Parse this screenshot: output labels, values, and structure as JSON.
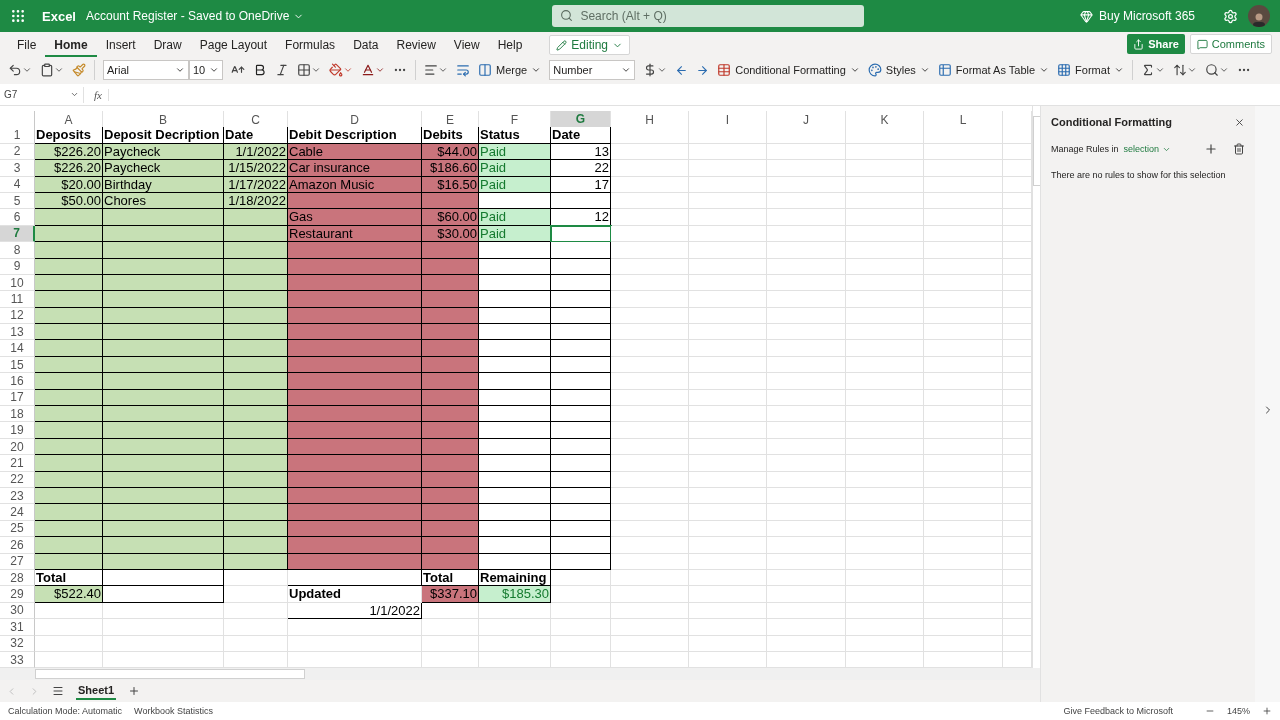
{
  "app": {
    "name": "Excel",
    "document": "Account Register - Saved to OneDrive"
  },
  "search": {
    "placeholder": "Search (Alt + Q)"
  },
  "account": {
    "buy": "Buy Microsoft 365"
  },
  "menu_tabs": [
    {
      "label": "File",
      "selected": false
    },
    {
      "label": "Home",
      "selected": true
    },
    {
      "label": "Insert",
      "selected": false
    },
    {
      "label": "Draw",
      "selected": false
    },
    {
      "label": "Page Layout",
      "selected": false
    },
    {
      "label": "Formulas",
      "selected": false
    },
    {
      "label": "Data",
      "selected": false
    },
    {
      "label": "Review",
      "selected": false
    },
    {
      "label": "View",
      "selected": false
    },
    {
      "label": "Help",
      "selected": false
    }
  ],
  "mode": "Editing",
  "share": "Share",
  "comments": "Comments",
  "toolbar": {
    "font": "Arial",
    "size": "10",
    "merge": "Merge",
    "number_format": "Number",
    "conditional_formatting": "Conditional Formatting",
    "styles": "Styles",
    "format_as_table": "Format As Table",
    "format": "Format"
  },
  "formula_bar": {
    "name_box": "G7",
    "fx": "fx"
  },
  "columns": [
    {
      "label": "A",
      "selected": false
    },
    {
      "label": "B",
      "selected": false
    },
    {
      "label": "C",
      "selected": false
    },
    {
      "label": "D",
      "selected": false
    },
    {
      "label": "E",
      "selected": false
    },
    {
      "label": "F",
      "selected": false
    },
    {
      "label": "G",
      "selected": true
    },
    {
      "label": "H",
      "selected": false
    },
    {
      "label": "I",
      "selected": false
    },
    {
      "label": "J",
      "selected": false
    },
    {
      "label": "K",
      "selected": false
    },
    {
      "label": "L",
      "selected": false
    }
  ],
  "rows": [
    {
      "number": "1",
      "selected": false,
      "cells": [
        {
          "text": "Deposits",
          "kind": "boxed",
          "bold": true
        },
        {
          "text": "Deposit Decription",
          "kind": "boxed",
          "bold": true
        },
        {
          "text": "Date",
          "kind": "boxed",
          "bold": true
        },
        {
          "text": "Debit Description",
          "kind": "boxed",
          "bold": true
        },
        {
          "text": "Debits",
          "kind": "boxed",
          "bold": true
        },
        {
          "text": "Status",
          "kind": "boxed",
          "bold": true
        },
        {
          "text": "Date",
          "kind": "boxed",
          "bold": true
        }
      ]
    },
    {
      "number": "2",
      "selected": false,
      "cells": [
        {
          "text": "$226.20",
          "kind": "deposit",
          "right_aligned": true
        },
        {
          "text": "Paycheck",
          "kind": "deposit"
        },
        {
          "text": "1/1/2022",
          "kind": "deposit",
          "right_aligned": true
        },
        {
          "text": "Cable",
          "kind": "debit"
        },
        {
          "text": "$44.00",
          "kind": "debit",
          "right_aligned": true
        },
        {
          "text": "Paid",
          "kind": "paid"
        },
        {
          "text": "13",
          "kind": "boxed",
          "right_aligned": true
        }
      ]
    },
    {
      "number": "3",
      "selected": false,
      "cells": [
        {
          "text": "$226.20",
          "kind": "deposit",
          "right_aligned": true
        },
        {
          "text": "Paycheck",
          "kind": "deposit"
        },
        {
          "text": "1/15/2022",
          "kind": "deposit",
          "right_aligned": true
        },
        {
          "text": "Car insurance",
          "kind": "debit"
        },
        {
          "text": "$186.60",
          "kind": "debit",
          "right_aligned": true
        },
        {
          "text": "Paid",
          "kind": "paid"
        },
        {
          "text": "22",
          "kind": "boxed",
          "right_aligned": true
        }
      ]
    },
    {
      "number": "4",
      "selected": false,
      "cells": [
        {
          "text": "$20.00",
          "kind": "deposit",
          "right_aligned": true
        },
        {
          "text": "Birthday",
          "kind": "deposit"
        },
        {
          "text": "1/17/2022",
          "kind": "deposit",
          "right_aligned": true
        },
        {
          "text": "Amazon Music",
          "kind": "debit"
        },
        {
          "text": "$16.50",
          "kind": "debit",
          "right_aligned": true
        },
        {
          "text": "Paid",
          "kind": "paid"
        },
        {
          "text": "17",
          "kind": "boxed",
          "right_aligned": true
        }
      ]
    },
    {
      "number": "5",
      "selected": false,
      "cells": [
        {
          "text": "$50.00",
          "kind": "deposit",
          "right_aligned": true
        },
        {
          "text": "Chores",
          "kind": "deposit"
        },
        {
          "text": "1/18/2022",
          "kind": "deposit",
          "right_aligned": true
        },
        {
          "kind": "debit"
        },
        {
          "kind": "debit"
        },
        {
          "kind": "boxed"
        },
        {
          "kind": "boxed"
        }
      ]
    },
    {
      "number": "6",
      "selected": false,
      "cells": [
        {
          "kind": "deposit"
        },
        {
          "kind": "deposit"
        },
        {
          "kind": "deposit"
        },
        {
          "text": "Gas",
          "kind": "debit"
        },
        {
          "text": "$60.00",
          "kind": "debit",
          "right_aligned": true
        },
        {
          "text": "Paid",
          "kind": "paid"
        },
        {
          "text": "12",
          "kind": "boxed",
          "right_aligned": true
        }
      ]
    },
    {
      "number": "7",
      "selected": true,
      "cells": [
        {
          "kind": "deposit"
        },
        {
          "kind": "deposit"
        },
        {
          "kind": "deposit"
        },
        {
          "text": "Restaurant",
          "kind": "debit"
        },
        {
          "text": "$30.00",
          "kind": "debit",
          "right_aligned": true
        },
        {
          "text": "Paid",
          "kind": "paid"
        },
        {
          "kind": "boxed"
        }
      ]
    },
    {
      "number": "8",
      "selected": false,
      "cells": [
        {
          "kind": "deposit"
        },
        {
          "kind": "deposit"
        },
        {
          "kind": "deposit"
        },
        {
          "kind": "debit"
        },
        {
          "kind": "debit"
        },
        {
          "kind": "boxed"
        },
        {
          "kind": "boxed"
        }
      ]
    },
    {
      "number": "9",
      "selected": false,
      "cells": [
        {
          "kind": "deposit"
        },
        {
          "kind": "deposit"
        },
        {
          "kind": "deposit"
        },
        {
          "kind": "debit"
        },
        {
          "kind": "debit"
        },
        {
          "kind": "boxed"
        },
        {
          "kind": "boxed"
        }
      ]
    },
    {
      "number": "10",
      "selected": false,
      "cells": [
        {
          "kind": "deposit"
        },
        {
          "kind": "deposit"
        },
        {
          "kind": "deposit"
        },
        {
          "kind": "debit"
        },
        {
          "kind": "debit"
        },
        {
          "kind": "boxed"
        },
        {
          "kind": "boxed"
        }
      ]
    },
    {
      "number": "11",
      "selected": false,
      "cells": [
        {
          "kind": "deposit"
        },
        {
          "kind": "deposit"
        },
        {
          "kind": "deposit"
        },
        {
          "kind": "debit"
        },
        {
          "kind": "debit"
        },
        {
          "kind": "boxed"
        },
        {
          "kind": "boxed"
        }
      ]
    },
    {
      "number": "12",
      "selected": false,
      "cells": [
        {
          "kind": "deposit"
        },
        {
          "kind": "deposit"
        },
        {
          "kind": "deposit"
        },
        {
          "kind": "debit"
        },
        {
          "kind": "debit"
        },
        {
          "kind": "boxed"
        },
        {
          "kind": "boxed"
        }
      ]
    },
    {
      "number": "13",
      "selected": false,
      "cells": [
        {
          "kind": "deposit"
        },
        {
          "kind": "deposit"
        },
        {
          "kind": "deposit"
        },
        {
          "kind": "debit"
        },
        {
          "kind": "debit"
        },
        {
          "kind": "boxed"
        },
        {
          "kind": "boxed"
        }
      ]
    },
    {
      "number": "14",
      "selected": false,
      "cells": [
        {
          "kind": "deposit"
        },
        {
          "kind": "deposit"
        },
        {
          "kind": "deposit"
        },
        {
          "kind": "debit"
        },
        {
          "kind": "debit"
        },
        {
          "kind": "boxed"
        },
        {
          "kind": "boxed"
        }
      ]
    },
    {
      "number": "15",
      "selected": false,
      "cells": [
        {
          "kind": "deposit"
        },
        {
          "kind": "deposit"
        },
        {
          "kind": "deposit"
        },
        {
          "kind": "debit"
        },
        {
          "kind": "debit"
        },
        {
          "kind": "boxed"
        },
        {
          "kind": "boxed"
        }
      ]
    },
    {
      "number": "16",
      "selected": false,
      "cells": [
        {
          "kind": "deposit"
        },
        {
          "kind": "deposit"
        },
        {
          "kind": "deposit"
        },
        {
          "kind": "debit"
        },
        {
          "kind": "debit"
        },
        {
          "kind": "boxed"
        },
        {
          "kind": "boxed"
        }
      ]
    },
    {
      "number": "17",
      "selected": false,
      "cells": [
        {
          "kind": "deposit"
        },
        {
          "kind": "deposit"
        },
        {
          "kind": "deposit"
        },
        {
          "kind": "debit"
        },
        {
          "kind": "debit"
        },
        {
          "kind": "boxed"
        },
        {
          "kind": "boxed"
        }
      ]
    },
    {
      "number": "18",
      "selected": false,
      "cells": [
        {
          "kind": "deposit"
        },
        {
          "kind": "deposit"
        },
        {
          "kind": "deposit"
        },
        {
          "kind": "debit"
        },
        {
          "kind": "debit"
        },
        {
          "kind": "boxed"
        },
        {
          "kind": "boxed"
        }
      ]
    },
    {
      "number": "19",
      "selected": false,
      "cells": [
        {
          "kind": "deposit"
        },
        {
          "kind": "deposit"
        },
        {
          "kind": "deposit"
        },
        {
          "kind": "debit"
        },
        {
          "kind": "debit"
        },
        {
          "kind": "boxed"
        },
        {
          "kind": "boxed"
        }
      ]
    },
    {
      "number": "20",
      "selected": false,
      "cells": [
        {
          "kind": "deposit"
        },
        {
          "kind": "deposit"
        },
        {
          "kind": "deposit"
        },
        {
          "kind": "debit"
        },
        {
          "kind": "debit"
        },
        {
          "kind": "boxed"
        },
        {
          "kind": "boxed"
        }
      ]
    },
    {
      "number": "21",
      "selected": false,
      "cells": [
        {
          "kind": "deposit"
        },
        {
          "kind": "deposit"
        },
        {
          "kind": "deposit"
        },
        {
          "kind": "debit"
        },
        {
          "kind": "debit"
        },
        {
          "kind": "boxed"
        },
        {
          "kind": "boxed"
        }
      ]
    },
    {
      "number": "22",
      "selected": false,
      "cells": [
        {
          "kind": "deposit"
        },
        {
          "kind": "deposit"
        },
        {
          "kind": "deposit"
        },
        {
          "kind": "debit"
        },
        {
          "kind": "debit"
        },
        {
          "kind": "boxed"
        },
        {
          "kind": "boxed"
        }
      ]
    },
    {
      "number": "23",
      "selected": false,
      "cells": [
        {
          "kind": "deposit"
        },
        {
          "kind": "deposit"
        },
        {
          "kind": "deposit"
        },
        {
          "kind": "debit"
        },
        {
          "kind": "debit"
        },
        {
          "kind": "boxed"
        },
        {
          "kind": "boxed"
        }
      ]
    },
    {
      "number": "24",
      "selected": false,
      "cells": [
        {
          "kind": "deposit"
        },
        {
          "kind": "deposit"
        },
        {
          "kind": "deposit"
        },
        {
          "kind": "debit"
        },
        {
          "kind": "debit"
        },
        {
          "kind": "boxed"
        },
        {
          "kind": "boxed"
        }
      ]
    },
    {
      "number": "25",
      "selected": false,
      "cells": [
        {
          "kind": "deposit"
        },
        {
          "kind": "deposit"
        },
        {
          "kind": "deposit"
        },
        {
          "kind": "debit"
        },
        {
          "kind": "debit"
        },
        {
          "kind": "boxed"
        },
        {
          "kind": "boxed"
        }
      ]
    },
    {
      "number": "26",
      "selected": false,
      "cells": [
        {
          "kind": "deposit"
        },
        {
          "kind": "deposit"
        },
        {
          "kind": "deposit"
        },
        {
          "kind": "debit"
        },
        {
          "kind": "debit"
        },
        {
          "kind": "boxed"
        },
        {
          "kind": "boxed"
        }
      ]
    },
    {
      "number": "27",
      "selected": false,
      "cells": [
        {
          "kind": "deposit"
        },
        {
          "kind": "deposit"
        },
        {
          "kind": "deposit"
        },
        {
          "kind": "debit"
        },
        {
          "kind": "debit"
        },
        {
          "kind": "boxed"
        },
        {
          "kind": "boxed"
        }
      ]
    },
    {
      "number": "28",
      "selected": false,
      "cells": [
        {
          "text": "Total",
          "kind": "boxed",
          "bold": true
        },
        {
          "kind": "boxed"
        },
        {
          "kind": "plain"
        },
        {
          "kind": "boxed"
        },
        {
          "text": "Total",
          "kind": "boxed",
          "bold": true
        },
        {
          "text": "Remaining",
          "kind": "boxed",
          "bold": true
        }
      ]
    },
    {
      "number": "29",
      "selected": false,
      "cells": [
        {
          "text": "$522.40",
          "kind": "deposit",
          "right_aligned": true
        },
        {
          "kind": "boxed"
        },
        {
          "kind": "plain"
        },
        {
          "text": "Updated",
          "kind": "plain",
          "bold": true
        },
        {
          "text": "$337.10",
          "kind": "debit",
          "right_aligned": true
        },
        {
          "text": "$185.30",
          "kind": "paid",
          "right_aligned": true
        }
      ]
    },
    {
      "number": "30",
      "selected": false,
      "cells": [
        {
          "kind": "plain"
        },
        {
          "kind": "plain"
        },
        {
          "kind": "plain"
        },
        {
          "text": "1/1/2022",
          "kind": "boxed",
          "right_aligned": true
        }
      ]
    },
    {
      "number": "31",
      "selected": false
    },
    {
      "number": "32",
      "selected": false
    },
    {
      "number": "33",
      "selected": false
    }
  ],
  "side_panel": {
    "title": "Conditional Formatting",
    "manage_label": "Manage Rules in",
    "scope": "selection",
    "empty_message": "There are no rules to show for this selection"
  },
  "sheet_tabs": [
    {
      "label": "Sheet1",
      "selected": true
    }
  ],
  "status_bar": {
    "calculation": "Calculation Mode: Automatic",
    "statistics": "Workbook Statistics",
    "feedback": "Give Feedback to Microsoft",
    "zoom": "145%"
  }
}
